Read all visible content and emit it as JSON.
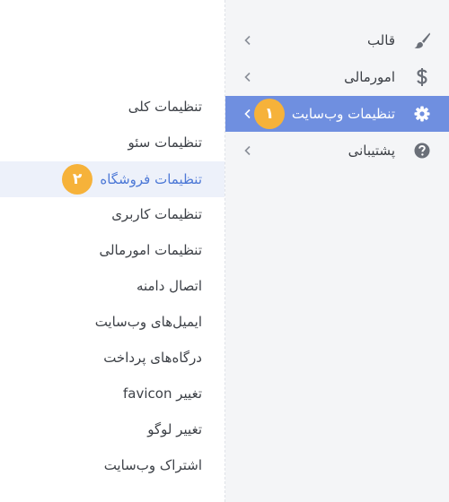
{
  "main_menu": {
    "items": [
      {
        "label": "قالب",
        "icon": "brush-icon"
      },
      {
        "label": "امورمالی",
        "icon": "dollar-icon"
      },
      {
        "label": "تنظیمات وب‌سایت",
        "icon": "gear-icon",
        "active": true,
        "badge": "۱"
      },
      {
        "label": "پشتیبانی",
        "icon": "help-circle-icon"
      }
    ]
  },
  "submenu": {
    "items": [
      {
        "label": "تنظیمات کلی"
      },
      {
        "label": "تنظیمات سئو"
      },
      {
        "label": "تنظیمات فروشگاه",
        "active": true,
        "badge": "۲"
      },
      {
        "label": "تنظیمات کاربری"
      },
      {
        "label": "تنظیمات امورمالی"
      },
      {
        "label": "اتصال دامنه"
      },
      {
        "label": "ایمیل‌های وب‌سایت"
      },
      {
        "label": "درگاه‌های پرداخت"
      },
      {
        "label": "تغییر favicon"
      },
      {
        "label": "تغییر لوگو"
      },
      {
        "label": "اشتراک وب‌سایت"
      }
    ]
  },
  "colors": {
    "accent": "#6f8fe0",
    "active_sub_bg": "#edf1fa",
    "active_sub_text": "#4c78d6",
    "badge": "#f6b23a",
    "sidebar_bg": "#f4f5f7"
  }
}
